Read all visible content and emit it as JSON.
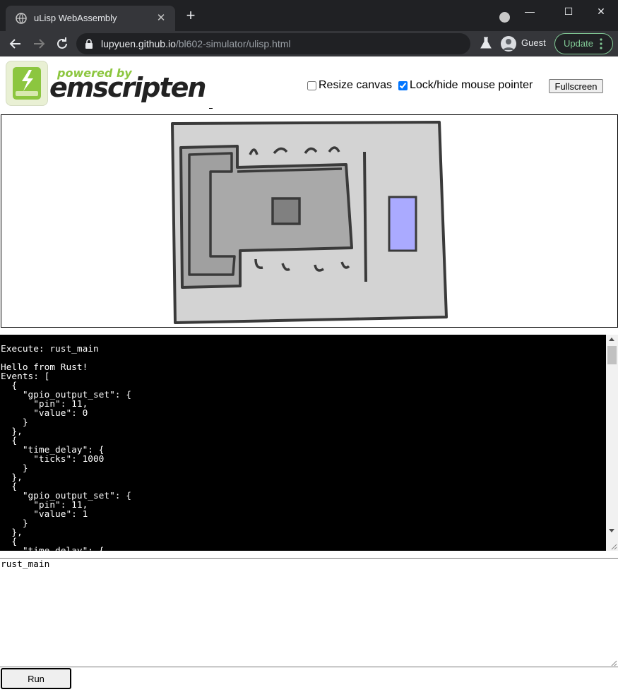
{
  "browser": {
    "tab_title": "uLisp WebAssembly",
    "tab_close": "✕",
    "new_tab": "+",
    "window_minimize": "—",
    "window_maximize": "☐",
    "window_close": "✕",
    "url_host": "lupyuen.github.io",
    "url_path": "/bl602-simulator/ulisp.html",
    "profile_label": "Guest",
    "update_label": "Update",
    "theme_color": "#202124",
    "update_color": "#81c995"
  },
  "header": {
    "logo_powered_by": "powered by",
    "logo_wordmark": "emscripten",
    "resize_canvas_label": "Resize canvas",
    "resize_canvas_checked": false,
    "lock_pointer_label": "Lock/hide mouse pointer",
    "lock_pointer_checked": true,
    "fullscreen_label": "Fullscreen"
  },
  "canvas": {
    "led_color": "#aaaaff",
    "board_color": "#d3d3d3"
  },
  "output": {
    "lines": [
      "Execute: rust_main",
      "",
      "Hello from Rust!",
      "Events: [",
      "  {",
      "    \"gpio_output_set\": {",
      "      \"pin\": 11,",
      "      \"value\": 0",
      "    }",
      "  },",
      "  {",
      "    \"time_delay\": {",
      "      \"ticks\": 1000",
      "    }",
      "  },",
      "  {",
      "    \"gpio_output_set\": {",
      "      \"pin\": 11,",
      "      \"value\": 1",
      "    }",
      "  },",
      "  {",
      "    \"time_delay\": {"
    ]
  },
  "command": {
    "value": "rust_main"
  },
  "run_label": "Run"
}
